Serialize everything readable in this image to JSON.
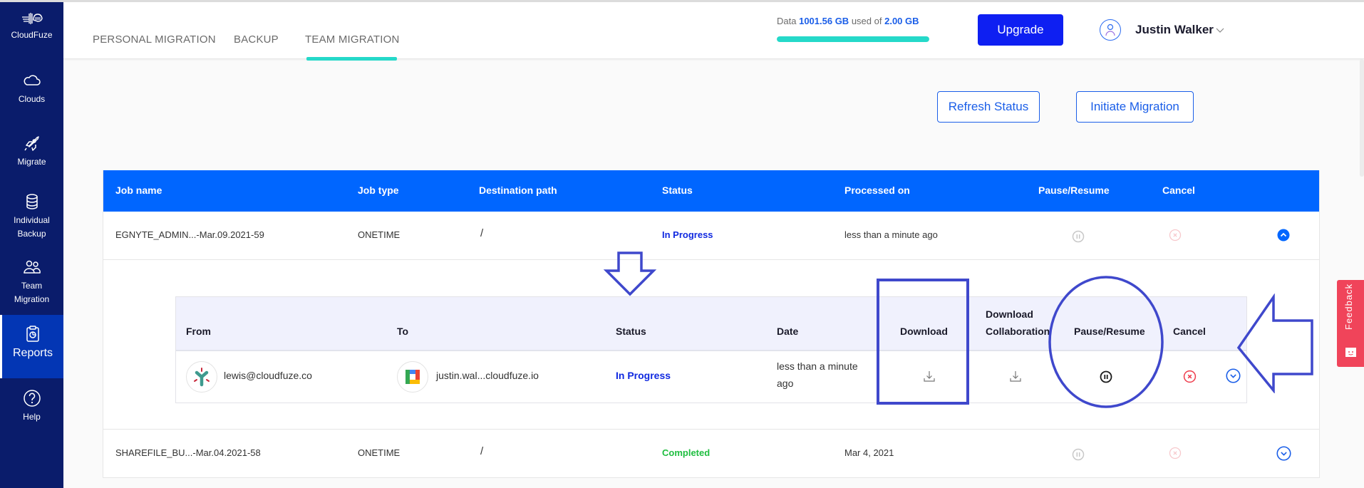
{
  "sidebar": {
    "brand": "CloudFuze",
    "items": [
      {
        "label": "Clouds",
        "icon": "cloud-icon"
      },
      {
        "label": "Migrate",
        "icon": "rocket-icon"
      },
      {
        "label": "Individual Backup",
        "icon": "database-icon"
      },
      {
        "label": "Team Migration",
        "icon": "users-icon"
      },
      {
        "label": "Reports",
        "icon": "report-icon",
        "active": true
      },
      {
        "label": "Help",
        "icon": "help-icon"
      }
    ]
  },
  "header": {
    "tabs": [
      {
        "label": "PERSONAL MIGRATION"
      },
      {
        "label": "BACKUP"
      },
      {
        "label": "TEAM MIGRATION",
        "active": true
      }
    ],
    "usage": {
      "prefix": "Data",
      "used": "1001.56 GB",
      "middle": "used of",
      "total": "2.00 GB",
      "fill_percent": 100
    },
    "upgrade_label": "Upgrade",
    "user_name": "Justin Walker"
  },
  "actions": {
    "refresh_label": "Refresh Status",
    "initiate_label": "Initiate Migration"
  },
  "table": {
    "columns": [
      "Job name",
      "Job type",
      "Destination path",
      "Status",
      "Processed on",
      "Pause/Resume",
      "Cancel"
    ],
    "rows": [
      {
        "job_name": "EGNYTE_ADMIN...-Mar.09.2021-59",
        "job_type": "ONETIME",
        "destination": "/",
        "status": "In Progress",
        "processed_on": "less than a minute ago",
        "expanded": true
      },
      {
        "job_name": "SHAREFILE_BU...-Mar.04.2021-58",
        "job_type": "ONETIME",
        "destination": "/",
        "status": "Completed",
        "processed_on": "Mar 4, 2021",
        "expanded": false
      }
    ]
  },
  "subtable": {
    "columns": [
      "From",
      "To",
      "Status",
      "Date",
      "Download",
      "Download Collaboration",
      "Pause/Resume",
      "Cancel"
    ],
    "col_download_collab_line1": "Download",
    "col_download_collab_line2": "Collaboration",
    "rows": [
      {
        "from": "lewis@cloudfuze.co",
        "from_cloud": "egnyte-logo",
        "to": "justin.wal...cloudfuze.io",
        "to_cloud": "google-workspace-logo",
        "status": "In Progress",
        "date_line1": "less than a minute",
        "date_line2": "ago"
      }
    ]
  },
  "feedback_label": "Feedback",
  "colors": {
    "sidebar": "#0a1c6b",
    "sidebar_active": "#0336b4",
    "accent_teal": "#25d9c9",
    "primary_blue": "#0066ff",
    "upgrade": "#0e1ff2",
    "in_progress": "#1029e0",
    "completed": "#1fbe40",
    "annotation": "#3f48cc",
    "feedback": "#f0445a"
  }
}
